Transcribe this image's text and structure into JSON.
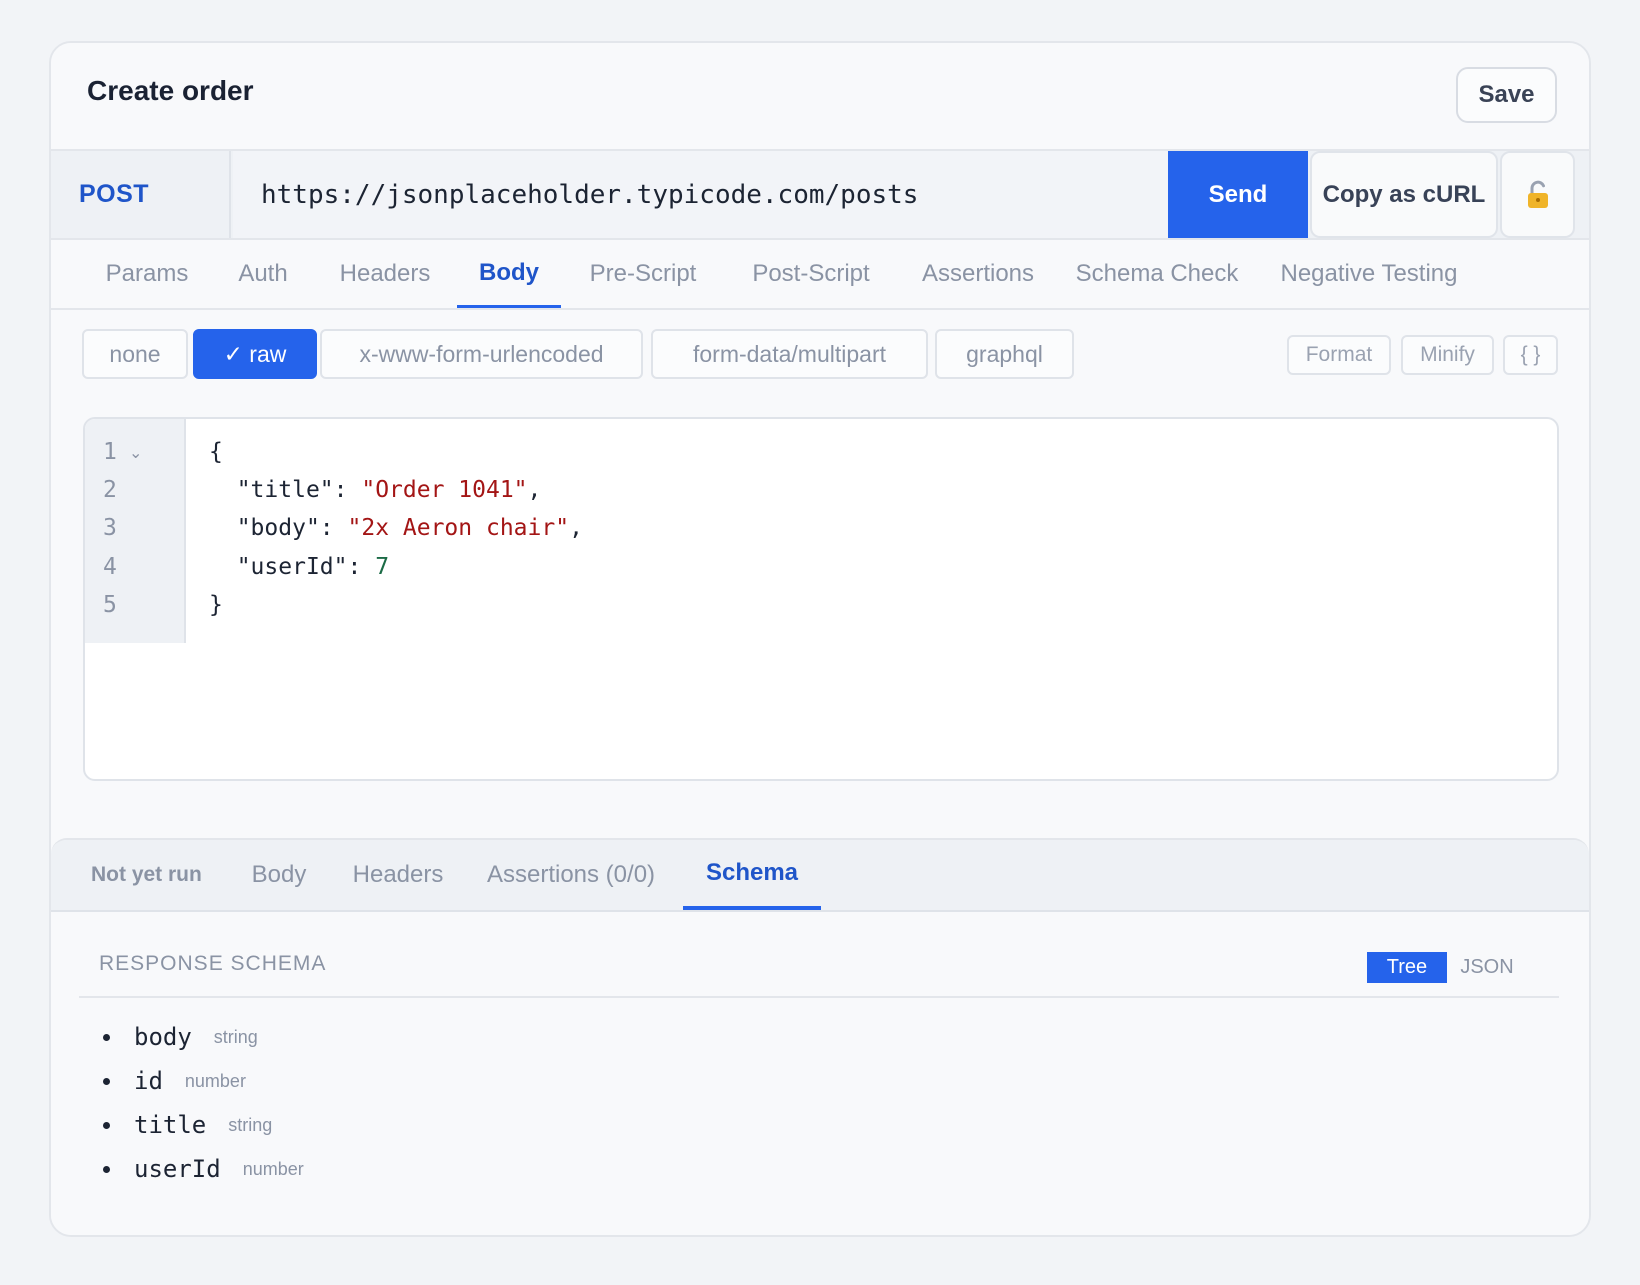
{
  "header": {
    "title": "Create order",
    "save_label": "Save"
  },
  "request": {
    "method": "POST",
    "url": "https://jsonplaceholder.typicode.com/posts",
    "send_label": "Send",
    "copy_curl_label": "Copy as cURL",
    "lock_icon": "🔓"
  },
  "request_tabs": [
    "Params",
    "Auth",
    "Headers",
    "Body",
    "Pre-Script",
    "Post-Script",
    "Assertions",
    "Schema Check",
    "Negative Testing"
  ],
  "active_request_tab": "Body",
  "body_types": [
    "none",
    "✓ raw",
    "x-www-form-urlencoded",
    "form-data/multipart",
    "graphql"
  ],
  "active_body_type": "✓ raw",
  "editor_tools": [
    "Format",
    "Minify",
    "{ }"
  ],
  "editor": {
    "line_numbers": [
      "1",
      "2",
      "3",
      "4",
      "5"
    ],
    "fold_marker": "⌄",
    "lines": {
      "l1": "{",
      "l2_key": "\"title\"",
      "l2_val": "\"Order 1041\"",
      "l3_key": "\"body\"",
      "l3_val": "\"2x Aeron chair\"",
      "l4_key": "\"userId\"",
      "l4_val": "7",
      "l5": "}"
    }
  },
  "response": {
    "status": "Not yet run",
    "tabs": [
      "Body",
      "Headers",
      "Assertions (0/0)",
      "Schema"
    ],
    "active_tab": "Schema",
    "schema_heading": "RESPONSE SCHEMA",
    "view_tree": "Tree",
    "view_json": "JSON",
    "fields": [
      {
        "name": "body",
        "type": "string"
      },
      {
        "name": "id",
        "type": "number"
      },
      {
        "name": "title",
        "type": "string"
      },
      {
        "name": "userId",
        "type": "number"
      }
    ]
  },
  "colors": {
    "accent": "#2563eb",
    "string": "#a31515",
    "number": "#1b6b46"
  }
}
